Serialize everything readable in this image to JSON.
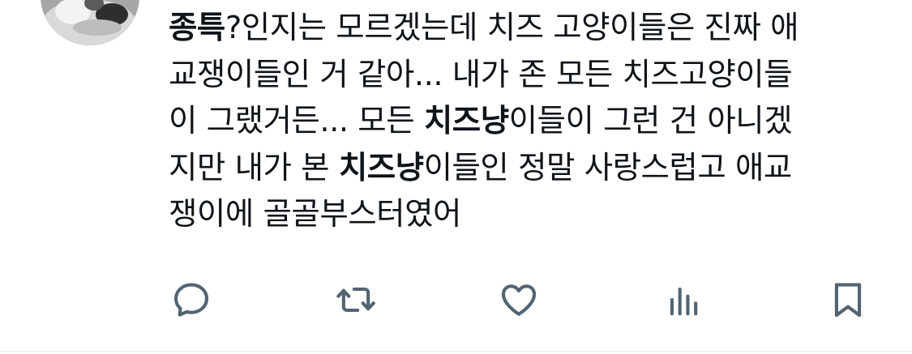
{
  "tweet": {
    "lines": [
      [
        {
          "text": "종특",
          "bold": true
        },
        {
          "text": "?인지는 모르겠는데 치즈 고양이들은 진짜 애",
          "bold": false
        }
      ],
      [
        {
          "text": "교쟁이들인 거 같아... 내가 존 모든 치즈고양이들",
          "bold": false
        }
      ],
      [
        {
          "text": "이 그랬거든... 모든 ",
          "bold": false
        },
        {
          "text": "치즈냥",
          "bold": true
        },
        {
          "text": "이들이 그런 건 아니겠",
          "bold": false
        }
      ],
      [
        {
          "text": "지만 내가 본 ",
          "bold": false
        },
        {
          "text": "치즈냥",
          "bold": true
        },
        {
          "text": "이들인 정말 사랑스럽고 애교",
          "bold": false
        }
      ],
      [
        {
          "text": "쟁이에 골골부스터였어",
          "bold": false
        }
      ]
    ]
  },
  "actions": {
    "reply": {
      "icon": "reply-icon"
    },
    "retweet": {
      "icon": "retweet-icon"
    },
    "like": {
      "icon": "heart-icon"
    },
    "views": {
      "icon": "analytics-icon"
    },
    "bookmark": {
      "icon": "bookmark-icon"
    }
  },
  "colors": {
    "text": "#0f1419",
    "icon": "#536471",
    "divider": "#eff3f4"
  }
}
